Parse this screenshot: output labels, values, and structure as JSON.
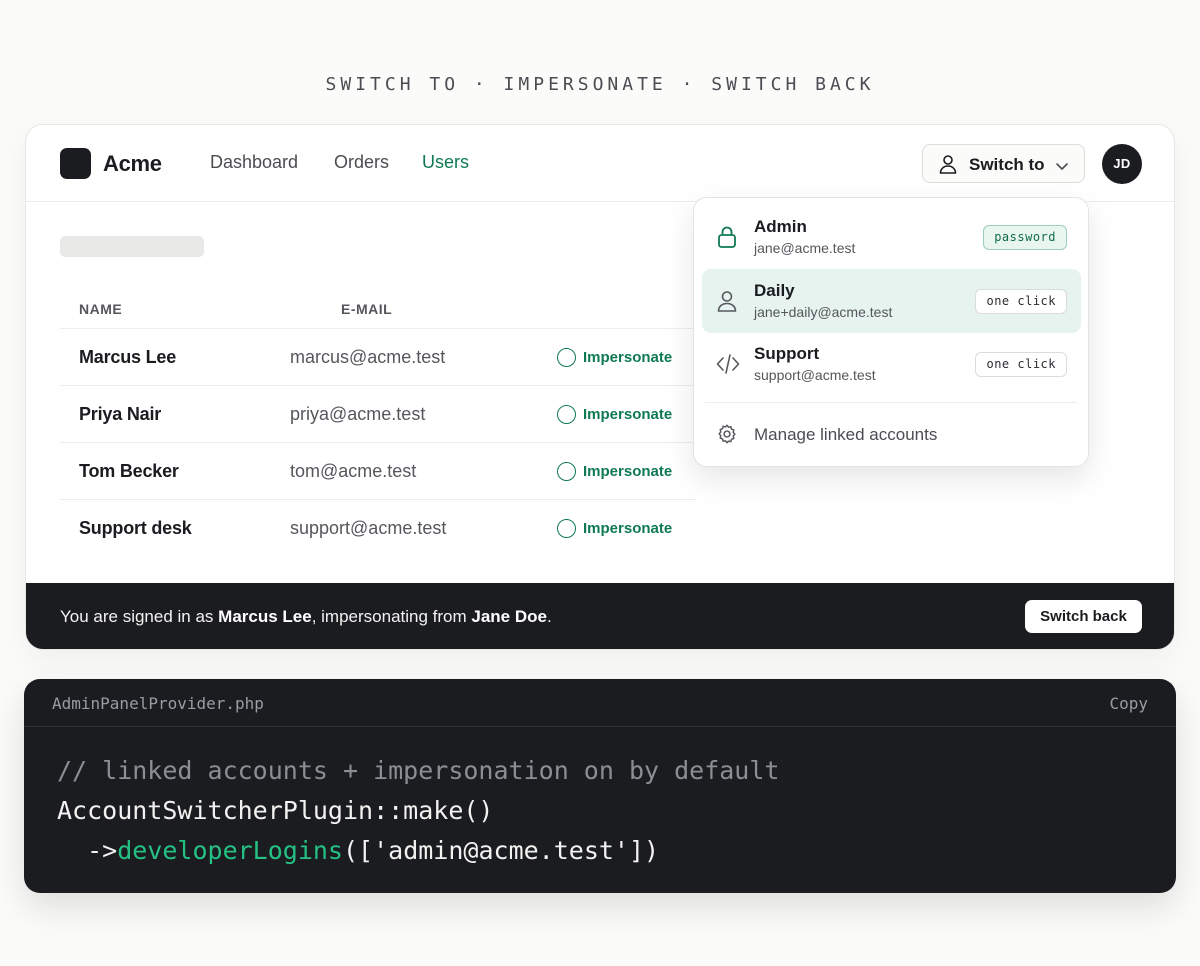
{
  "caption": "SWITCH TO · IMPERSONATE · SWITCH BACK",
  "app": {
    "brand": "Acme",
    "nav": [
      {
        "label": "Dashboard",
        "active": false
      },
      {
        "label": "Orders",
        "active": false
      },
      {
        "label": "Users",
        "active": true
      }
    ],
    "switch_to_label": "Switch to",
    "avatar_initials": "JD",
    "accent_color": "#0f7a52"
  },
  "table": {
    "columns": [
      "NAME",
      "E-MAIL"
    ],
    "action_label": "Impersonate",
    "rows": [
      {
        "name": "Marcus Lee",
        "email": "marcus@acme.test"
      },
      {
        "name": "Priya Nair",
        "email": "priya@acme.test"
      },
      {
        "name": "Tom Becker",
        "email": "tom@acme.test"
      },
      {
        "name": "Support desk",
        "email": "support@acme.test"
      }
    ]
  },
  "dropdown": {
    "items": [
      {
        "title": "Admin",
        "email": "jane@acme.test",
        "badge": "password",
        "icon": "lock-icon",
        "selected": false
      },
      {
        "title": "Daily",
        "email": "jane+daily@acme.test",
        "badge": "one click",
        "icon": "user-icon",
        "selected": true
      },
      {
        "title": "Support",
        "email": "support@acme.test",
        "badge": "one click",
        "icon": "code-icon",
        "selected": false
      }
    ],
    "manage_label": "Manage linked accounts"
  },
  "banner": {
    "prefix": "You are signed in as ",
    "user": "Marcus Lee",
    "middle": ", impersonating from ",
    "origin": "Jane Doe",
    "suffix": ".",
    "button": "Switch back"
  },
  "code": {
    "filename": "AdminPanelProvider.php",
    "copy_label": "Copy",
    "comment": "// linked accounts + impersonation on by default",
    "line2": "AccountSwitcherPlugin::make()",
    "line3_prefix": "  ->",
    "line3_fn": "developerLogins",
    "line3_args": "(['admin@acme.test'])"
  }
}
